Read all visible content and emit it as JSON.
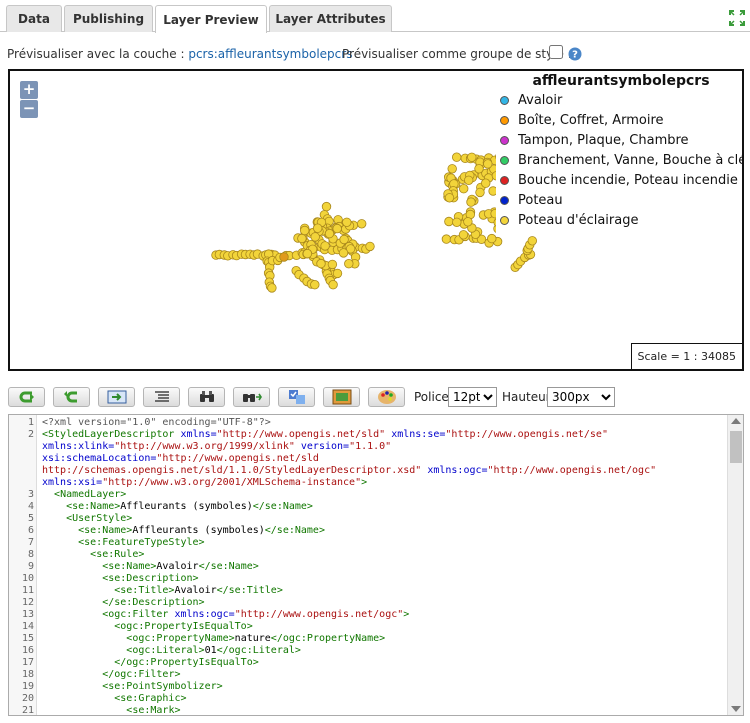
{
  "tabs": [
    {
      "label": "Data"
    },
    {
      "label": "Publishing"
    },
    {
      "label": "Layer Preview"
    },
    {
      "label": "Layer Attributes"
    }
  ],
  "active_tab": "Layer Preview",
  "preview": {
    "label": "Prévisualiser avec la couche :",
    "layer": "pcrs:affleurantsymbolepcrs",
    "group_label": "Prévisualiser comme groupe de style :",
    "group_checked": false
  },
  "map": {
    "zoom_in": "+",
    "zoom_out": "−",
    "legend_title": "affleurantsymbolepcrs",
    "legend": [
      {
        "label": "Avaloir",
        "color": "#33b5e5"
      },
      {
        "label": "Boîte, Coffret, Armoire",
        "color": "#ff9900"
      },
      {
        "label": "Tampon, Plaque, Chambre",
        "color": "#cc33cc"
      },
      {
        "label": "Branchement, Vanne, Bouche à clé",
        "color": "#33cc66"
      },
      {
        "label": "Bouche incendie, Poteau incendie",
        "color": "#dd2222"
      },
      {
        "label": "Poteau",
        "color": "#0022cc"
      },
      {
        "label": "Poteau d'éclairage",
        "color": "#f2d43a"
      }
    ],
    "scale": "Scale = 1 : 34085"
  },
  "toolbar": {
    "buttons": [
      "undo-icon",
      "redo-icon",
      "goto-line-icon",
      "format-icon",
      "find-icon",
      "replace-icon",
      "validate-icon",
      "preview-image-icon",
      "color-palette-icon"
    ],
    "font_label": "Police",
    "font_value": "12pt",
    "font_options": [
      "12pt"
    ],
    "height_label": "Hauteur",
    "height_value": "300px",
    "height_options": [
      "300px"
    ]
  },
  "editor": {
    "colors": {
      "tag": "#170",
      "attr": "#00c",
      "value": "#a11",
      "text": "#000",
      "pi": "#555"
    },
    "lines": [
      {
        "n": "1",
        "parts": [
          [
            "pi",
            "<?xml version=\"1.0\" encoding=\"UTF-8\"?>"
          ]
        ]
      },
      {
        "n": "2",
        "parts": [
          [
            "tag",
            "<StyledLayerDescriptor "
          ],
          [
            "attr",
            "xmlns="
          ],
          [
            "value",
            "\"http://www.opengis.net/sld\""
          ],
          [
            "attr",
            " xmlns:se="
          ],
          [
            "value",
            "\"http://www.opengis.net/se\""
          ]
        ]
      },
      {
        "n": "",
        "parts": [
          [
            "attr",
            "xmlns:xlink="
          ],
          [
            "value",
            "\"http://www.w3.org/1999/xlink\""
          ],
          [
            "attr",
            " version="
          ],
          [
            "value",
            "\"1.1.0\""
          ]
        ]
      },
      {
        "n": "",
        "parts": [
          [
            "attr",
            "xsi:schemaLocation="
          ],
          [
            "value",
            "\"http://www.opengis.net/sld"
          ]
        ]
      },
      {
        "n": "",
        "parts": [
          [
            "value",
            "http://schemas.opengis.net/sld/1.1.0/StyledLayerDescriptor.xsd\""
          ],
          [
            "attr",
            " xmlns:ogc="
          ],
          [
            "value",
            "\"http://www.opengis.net/ogc\""
          ]
        ]
      },
      {
        "n": "",
        "parts": [
          [
            "attr",
            "xmlns:xsi="
          ],
          [
            "value",
            "\"http://www.w3.org/2001/XMLSchema-instance\""
          ],
          [
            "tag",
            ">"
          ]
        ]
      },
      {
        "n": "3",
        "parts": [
          [
            "text",
            "  "
          ],
          [
            "tag",
            "<NamedLayer>"
          ]
        ]
      },
      {
        "n": "4",
        "parts": [
          [
            "text",
            "    "
          ],
          [
            "tag",
            "<se:Name>"
          ],
          [
            "text",
            "Affleurants (symboles)"
          ],
          [
            "tag",
            "</se:Name>"
          ]
        ]
      },
      {
        "n": "5",
        "parts": [
          [
            "text",
            "    "
          ],
          [
            "tag",
            "<UserStyle>"
          ]
        ]
      },
      {
        "n": "6",
        "parts": [
          [
            "text",
            "      "
          ],
          [
            "tag",
            "<se:Name>"
          ],
          [
            "text",
            "Affleurants (symboles)"
          ],
          [
            "tag",
            "</se:Name>"
          ]
        ]
      },
      {
        "n": "7",
        "parts": [
          [
            "text",
            "      "
          ],
          [
            "tag",
            "<se:FeatureTypeStyle>"
          ]
        ]
      },
      {
        "n": "8",
        "parts": [
          [
            "text",
            "        "
          ],
          [
            "tag",
            "<se:Rule>"
          ]
        ]
      },
      {
        "n": "9",
        "parts": [
          [
            "text",
            "          "
          ],
          [
            "tag",
            "<se:Name>"
          ],
          [
            "text",
            "Avaloir"
          ],
          [
            "tag",
            "</se:Name>"
          ]
        ]
      },
      {
        "n": "10",
        "parts": [
          [
            "text",
            "          "
          ],
          [
            "tag",
            "<se:Description>"
          ]
        ]
      },
      {
        "n": "11",
        "parts": [
          [
            "text",
            "            "
          ],
          [
            "tag",
            "<se:Title>"
          ],
          [
            "text",
            "Avaloir"
          ],
          [
            "tag",
            "</se:Title>"
          ]
        ]
      },
      {
        "n": "12",
        "parts": [
          [
            "text",
            "          "
          ],
          [
            "tag",
            "</se:Description>"
          ]
        ]
      },
      {
        "n": "13",
        "parts": [
          [
            "text",
            "          "
          ],
          [
            "tag",
            "<ogc:Filter "
          ],
          [
            "attr",
            "xmlns:ogc="
          ],
          [
            "value",
            "\"http://www.opengis.net/ogc\""
          ],
          [
            "tag",
            ">"
          ]
        ]
      },
      {
        "n": "14",
        "parts": [
          [
            "text",
            "            "
          ],
          [
            "tag",
            "<ogc:PropertyIsEqualTo>"
          ]
        ]
      },
      {
        "n": "15",
        "parts": [
          [
            "text",
            "              "
          ],
          [
            "tag",
            "<ogc:PropertyName>"
          ],
          [
            "text",
            "nature"
          ],
          [
            "tag",
            "</ogc:PropertyName>"
          ]
        ]
      },
      {
        "n": "16",
        "parts": [
          [
            "text",
            "              "
          ],
          [
            "tag",
            "<ogc:Literal>"
          ],
          [
            "text",
            "01"
          ],
          [
            "tag",
            "</ogc:Literal>"
          ]
        ]
      },
      {
        "n": "17",
        "parts": [
          [
            "text",
            "            "
          ],
          [
            "tag",
            "</ogc:PropertyIsEqualTo>"
          ]
        ]
      },
      {
        "n": "18",
        "parts": [
          [
            "text",
            "          "
          ],
          [
            "tag",
            "</ogc:Filter>"
          ]
        ]
      },
      {
        "n": "19",
        "parts": [
          [
            "text",
            "          "
          ],
          [
            "tag",
            "<se:PointSymbolizer>"
          ]
        ]
      },
      {
        "n": "20",
        "parts": [
          [
            "text",
            "            "
          ],
          [
            "tag",
            "<se:Graphic>"
          ]
        ]
      },
      {
        "n": "21",
        "parts": [
          [
            "text",
            "              "
          ],
          [
            "tag",
            "<se:Mark>"
          ]
        ]
      }
    ]
  }
}
